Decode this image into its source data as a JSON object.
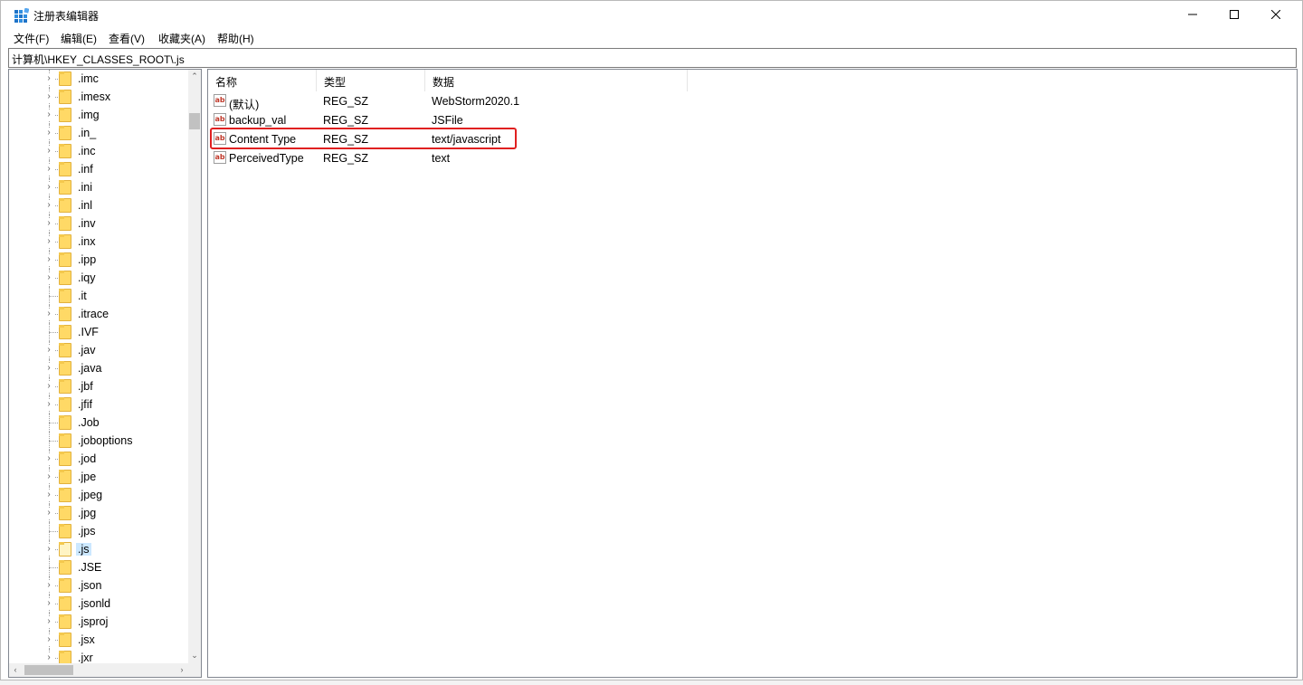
{
  "window": {
    "title": "注册表编辑器",
    "minimize_glyph": "—",
    "maximize_glyph": "☐",
    "close_glyph": "✕"
  },
  "menu": [
    "文件(F)",
    "编辑(E)",
    "查看(V)",
    "收藏夹(A)",
    "帮助(H)"
  ],
  "address": "计算机\\HKEY_CLASSES_ROOT\\.js",
  "tree": {
    "items": [
      {
        "label": ".imc",
        "expandable": true
      },
      {
        "label": ".imesx",
        "expandable": true
      },
      {
        "label": ".img",
        "expandable": true
      },
      {
        "label": ".in_",
        "expandable": true
      },
      {
        "label": ".inc",
        "expandable": true
      },
      {
        "label": ".inf",
        "expandable": true
      },
      {
        "label": ".ini",
        "expandable": true
      },
      {
        "label": ".inl",
        "expandable": true
      },
      {
        "label": ".inv",
        "expandable": true
      },
      {
        "label": ".inx",
        "expandable": true
      },
      {
        "label": ".ipp",
        "expandable": true
      },
      {
        "label": ".iqy",
        "expandable": true
      },
      {
        "label": ".it",
        "expandable": false
      },
      {
        "label": ".itrace",
        "expandable": true
      },
      {
        "label": ".IVF",
        "expandable": false
      },
      {
        "label": ".jav",
        "expandable": true
      },
      {
        "label": ".java",
        "expandable": true
      },
      {
        "label": ".jbf",
        "expandable": true
      },
      {
        "label": ".jfif",
        "expandable": true
      },
      {
        "label": ".Job",
        "expandable": false
      },
      {
        "label": ".joboptions",
        "expandable": false
      },
      {
        "label": ".jod",
        "expandable": true
      },
      {
        "label": ".jpe",
        "expandable": true
      },
      {
        "label": ".jpeg",
        "expandable": true
      },
      {
        "label": ".jpg",
        "expandable": true
      },
      {
        "label": ".jps",
        "expandable": false
      },
      {
        "label": ".js",
        "expandable": true,
        "selected": true
      },
      {
        "label": ".JSE",
        "expandable": false
      },
      {
        "label": ".json",
        "expandable": true
      },
      {
        "label": ".jsonld",
        "expandable": true
      },
      {
        "label": ".jsproj",
        "expandable": true
      },
      {
        "label": ".jsx",
        "expandable": true
      },
      {
        "label": ".jxr",
        "expandable": true
      }
    ]
  },
  "values": {
    "columns": {
      "name": "名称",
      "type": "类型",
      "data": "数据"
    },
    "icon_text": "ab",
    "rows": [
      {
        "name": "(默认)",
        "type": "REG_SZ",
        "data": "WebStorm2020.1"
      },
      {
        "name": "backup_val",
        "type": "REG_SZ",
        "data": "JSFile"
      },
      {
        "name": "Content Type",
        "type": "REG_SZ",
        "data": "text/javascript",
        "highlighted": true
      },
      {
        "name": "PerceivedType",
        "type": "REG_SZ",
        "data": "text"
      }
    ]
  },
  "colors": {
    "highlight_border": "#e02020",
    "selection_bg": "#cce8ff",
    "folder": "#ffd966"
  }
}
